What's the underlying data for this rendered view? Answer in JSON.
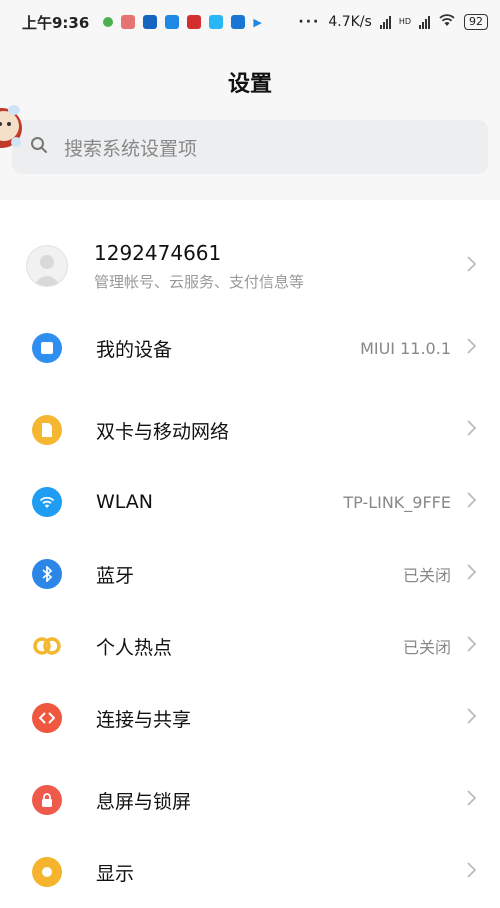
{
  "status_bar": {
    "time": "上午9:36",
    "more": "···",
    "speed": "4.7K/s",
    "network": "HD",
    "battery": "92"
  },
  "header": {
    "title": "设置"
  },
  "search": {
    "placeholder": "搜索系统设置项"
  },
  "account": {
    "name": "1292474661",
    "subtitle": "管理帐号、云服务、支付信息等"
  },
  "items": [
    {
      "label": "我的设备",
      "value": "MIUI 11.0.1",
      "icon": "device-icon",
      "color": "#2f8ff0"
    },
    {
      "label": "双卡与移动网络",
      "value": "",
      "icon": "sim-card-icon",
      "color": "#f5b731"
    },
    {
      "label": "WLAN",
      "value": "TP-LINK_9FFE",
      "icon": "wifi-icon",
      "color": "#1e9df2"
    },
    {
      "label": "蓝牙",
      "value": "已关闭",
      "icon": "bluetooth-icon",
      "color": "#2b86e8"
    },
    {
      "label": "个人热点",
      "value": "已关闭",
      "icon": "hotspot-icon",
      "color": "#f3b730"
    },
    {
      "label": "连接与共享",
      "value": "",
      "icon": "connection-share-icon",
      "color": "#f0573f"
    },
    {
      "label": "息屏与锁屏",
      "value": "",
      "icon": "lock-icon",
      "color": "#f05a4b"
    },
    {
      "label": "显示",
      "value": "",
      "icon": "display-icon",
      "color": "#f5b32e"
    }
  ]
}
